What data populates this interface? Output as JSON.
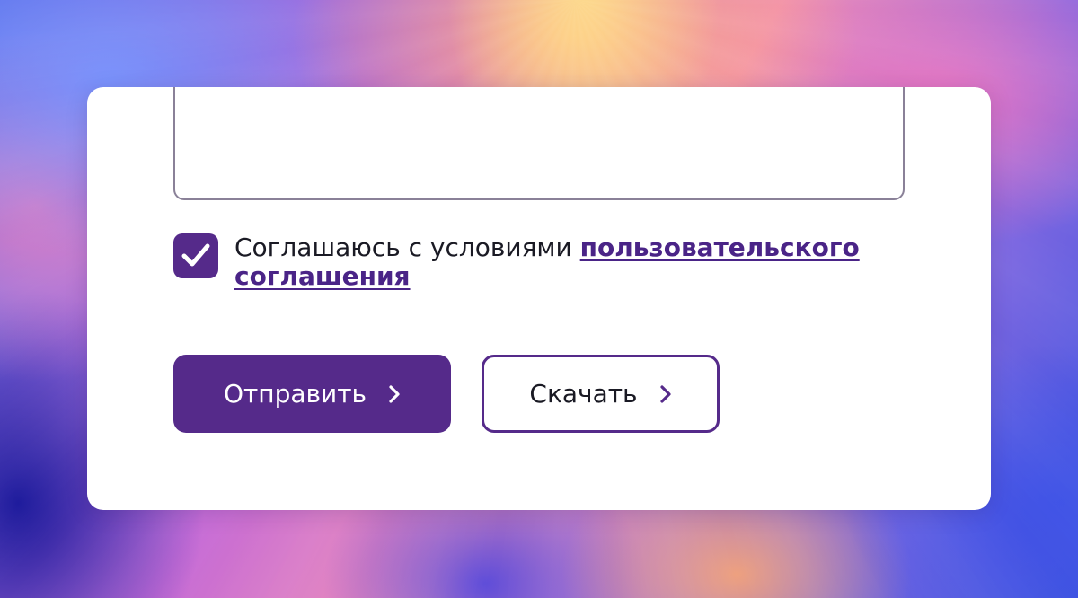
{
  "form": {
    "agreement": {
      "checked": true,
      "text_prefix": "Соглашаюсь с условиями ",
      "link_text": "пользовательского соглашения"
    },
    "buttons": {
      "submit_label": "Отправить",
      "download_label": "Скачать"
    },
    "icons": {
      "checkbox": "checkmark-icon",
      "submit_chevron": "chevron-right-icon",
      "download_chevron": "chevron-right-icon"
    }
  },
  "colors": {
    "accent": "#552a8a",
    "link": "#4a2487",
    "text": "#1a1a24",
    "textarea_border": "#8a8198"
  }
}
